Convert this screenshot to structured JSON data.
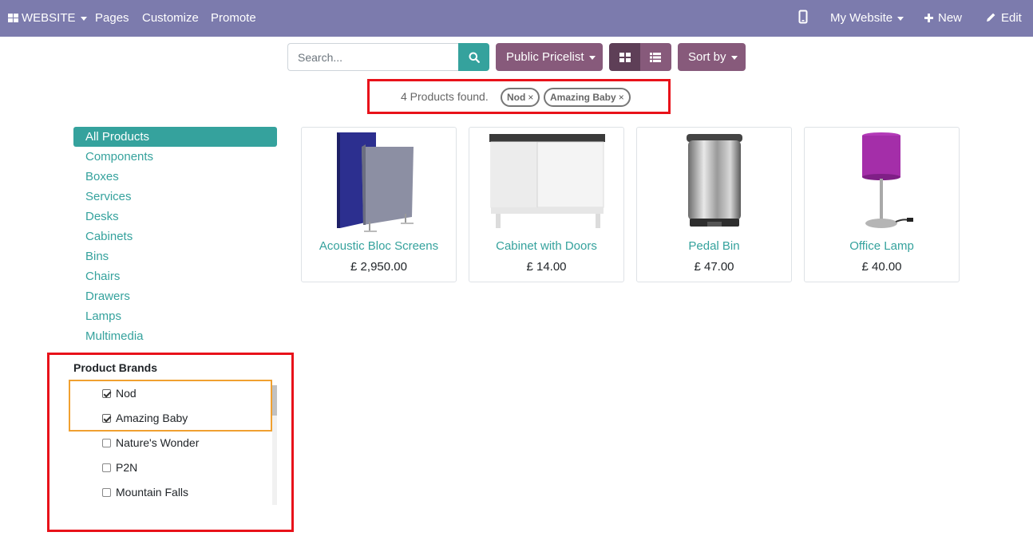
{
  "topbar": {
    "app_label": "WEBSITE",
    "menu": [
      "Pages",
      "Customize",
      "Promote"
    ],
    "site_label": "My Website",
    "new_label": "New",
    "edit_label": "Edit",
    "bg_color": "#7c7bad"
  },
  "toolbar": {
    "search_placeholder": "Search...",
    "pricelist_label": "Public Pricelist",
    "sort_label": "Sort by",
    "view_mode": "grid"
  },
  "filters": {
    "found_text": "4 Products found.",
    "chips": [
      {
        "label": "Nod",
        "remove": "×"
      },
      {
        "label": "Amazing Baby",
        "remove": "×"
      }
    ]
  },
  "categories": [
    {
      "label": "All Products",
      "active": true
    },
    {
      "label": "Components"
    },
    {
      "label": "Boxes"
    },
    {
      "label": "Services"
    },
    {
      "label": "Desks"
    },
    {
      "label": "Cabinets"
    },
    {
      "label": "Bins"
    },
    {
      "label": "Chairs"
    },
    {
      "label": "Drawers"
    },
    {
      "label": "Lamps"
    },
    {
      "label": "Multimedia"
    }
  ],
  "brands": {
    "title": "Product Brands",
    "items": [
      {
        "label": "Nod",
        "checked": true
      },
      {
        "label": "Amazing Baby",
        "checked": true
      },
      {
        "label": "Nature's Wonder",
        "checked": false
      },
      {
        "label": "P2N",
        "checked": false
      },
      {
        "label": "Mountain Falls",
        "checked": false
      }
    ]
  },
  "products": [
    {
      "name": "Acoustic Bloc Screens",
      "price": "£ 2,950.00",
      "image": "acoustic-screens"
    },
    {
      "name": "Cabinet with Doors",
      "price": "£ 14.00",
      "image": "white-cabinet"
    },
    {
      "name": "Pedal Bin",
      "price": "£ 47.00",
      "image": "steel-pedal-bin"
    },
    {
      "name": "Office Lamp",
      "price": "£ 40.00",
      "image": "purple-lamp"
    }
  ],
  "colors": {
    "accent_teal": "#35a29d",
    "button_purple": "#875a7b",
    "highlight_red": "#e8121a",
    "highlight_orange": "#f0a030"
  }
}
